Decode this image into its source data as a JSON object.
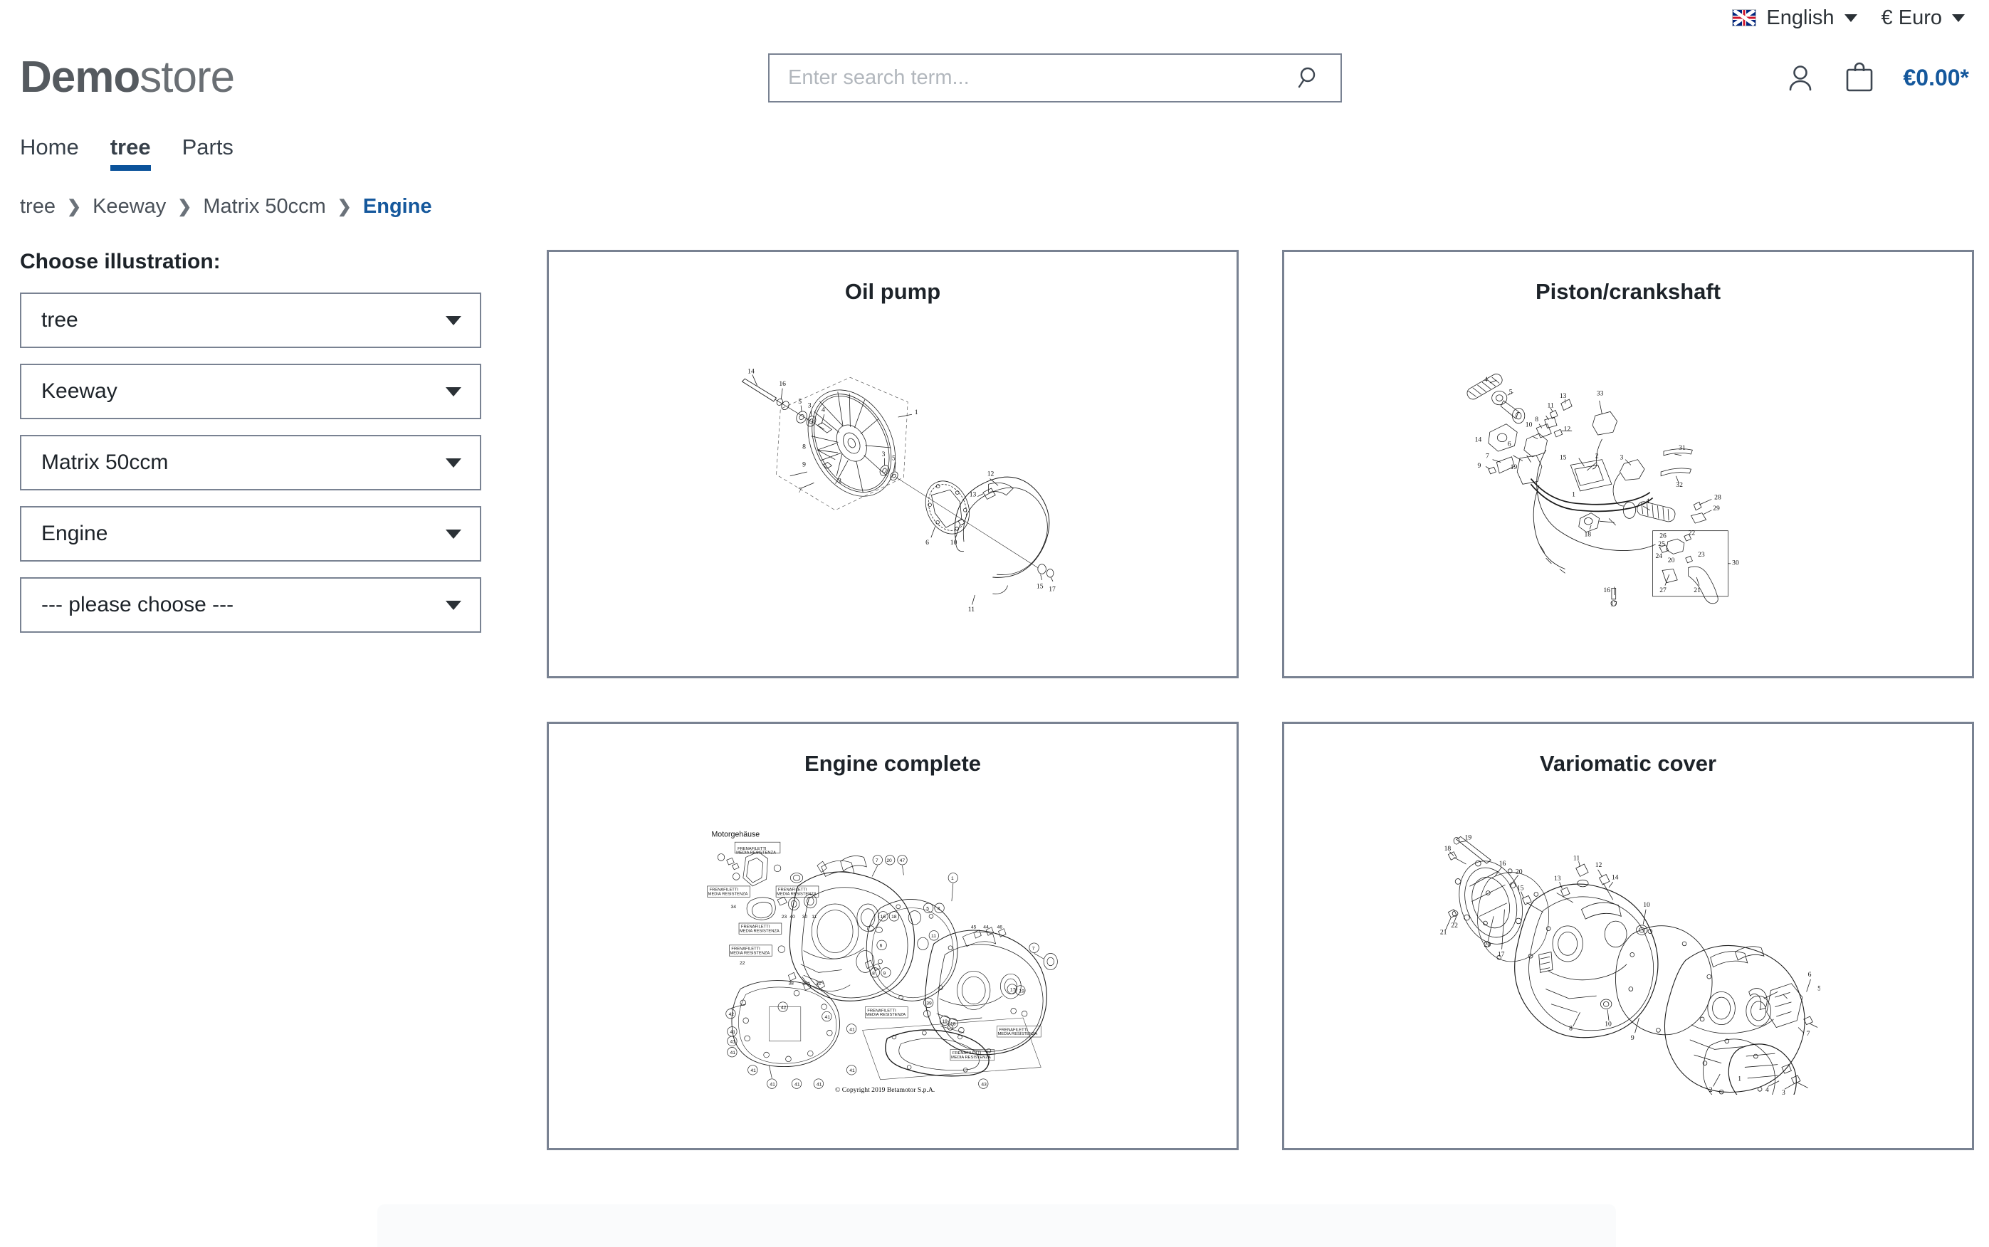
{
  "topbar": {
    "flag_icon": "uk-flag-icon",
    "language": "English",
    "currency": "€ Euro"
  },
  "header": {
    "logo_bold": "Demo",
    "logo_light": "store",
    "search": {
      "placeholder": "Enter search term...",
      "value": "",
      "icon": "search-icon"
    },
    "account_icon": "user-icon",
    "cart_icon": "shopping-bag-icon",
    "cart_total": "€0.00*"
  },
  "nav": {
    "items": [
      {
        "label": "Home",
        "active": false
      },
      {
        "label": "tree",
        "active": true
      },
      {
        "label": "Parts",
        "active": false
      }
    ]
  },
  "breadcrumb": {
    "items": [
      "tree",
      "Keeway",
      "Matrix 50ccm",
      "Engine"
    ],
    "separator": "❯"
  },
  "sidebar": {
    "title": "Choose illustration:",
    "selects": [
      {
        "value": "tree"
      },
      {
        "value": "Keeway"
      },
      {
        "value": "Matrix 50ccm"
      },
      {
        "value": "Engine"
      },
      {
        "value": "--- please choose ---"
      }
    ]
  },
  "cards": [
    {
      "title": "Oil pump",
      "illustration": "front-wheel-exploded-diagram"
    },
    {
      "title": "Piston/crankshaft",
      "illustration": "handlebar-assembly-exploded-diagram"
    },
    {
      "title": "Engine complete",
      "illustration": "engine-case-exploded-diagram",
      "caption": "Motorgehäuse",
      "copyright": "© Copyright 2019 Betamotor S.p.A."
    },
    {
      "title": "Variomatic cover",
      "illustration": "variomatic-cover-exploded-diagram"
    }
  ],
  "colors": {
    "accent_blue": "#15589c",
    "tab_underline": "#0b539b",
    "border_gray": "#798292",
    "text_dark": "#1d2329"
  }
}
